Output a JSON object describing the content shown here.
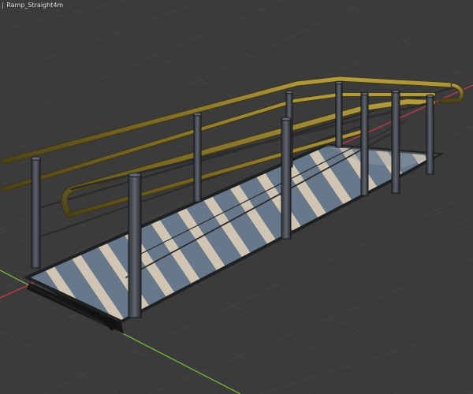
{
  "viewport": {
    "object_label": "Ramp_Straight4m",
    "object_prefix": "|"
  },
  "icons": {
    "axis_x": "x-axis-line-icon",
    "axis_y": "y-axis-line-icon"
  },
  "colors": {
    "background": "#3b3b3b",
    "grid": "#474747",
    "axis_x": "#d33a4a",
    "axis_y": "#7bbf3f",
    "rail_yellow": "#8f7d2d",
    "post_dark": "#4b5056",
    "deck_light": "#b8ad9d",
    "deck_dark": "#55636f"
  }
}
